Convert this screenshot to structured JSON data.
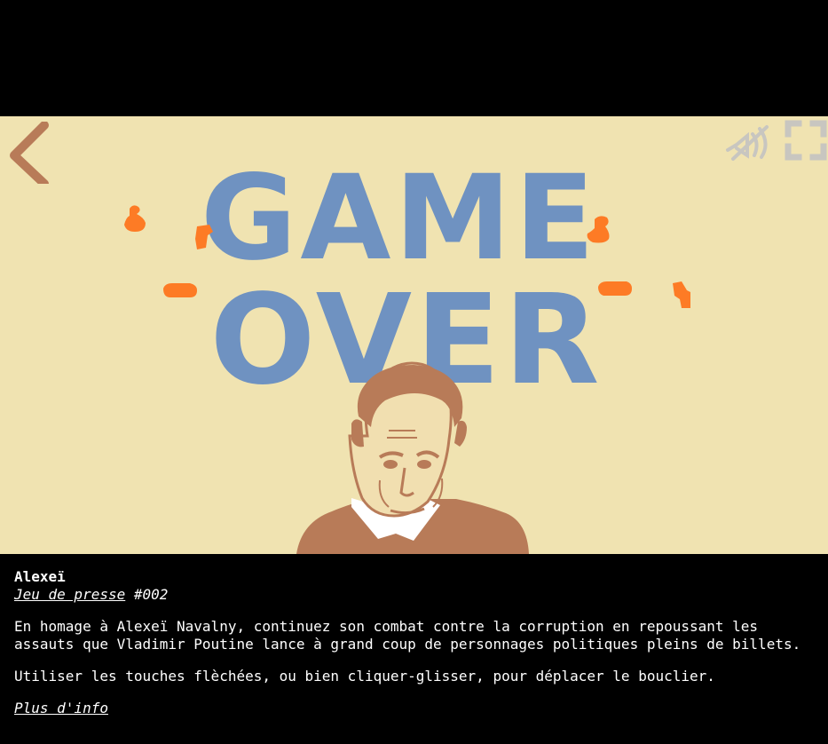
{
  "game": {
    "headline_line1": "GAME",
    "headline_line2": "OVER",
    "icons": {
      "back": "chevron-left-icon",
      "sound": "sound-off-icon",
      "fullscreen": "fullscreen-icon"
    },
    "colors": {
      "background": "#f0e3b1",
      "headline": "#6f92c1",
      "accent": "#fd7b25",
      "character": "#b87b58",
      "icon_gray": "#c8c6c0"
    }
  },
  "info": {
    "title": "Alexeï",
    "series_link": "Jeu de presse",
    "series_number": " #002",
    "description": "En homage à Alexeï Navalny, continuez son combat contre la corruption en repoussant les assauts que Vladimir Poutine lance à grand coup de personnages politiques pleins de billets.",
    "controls": "Utiliser les touches flèchées, ou bien cliquer-glisser, pour déplacer le bouclier.",
    "more_link": "Plus d'info"
  }
}
